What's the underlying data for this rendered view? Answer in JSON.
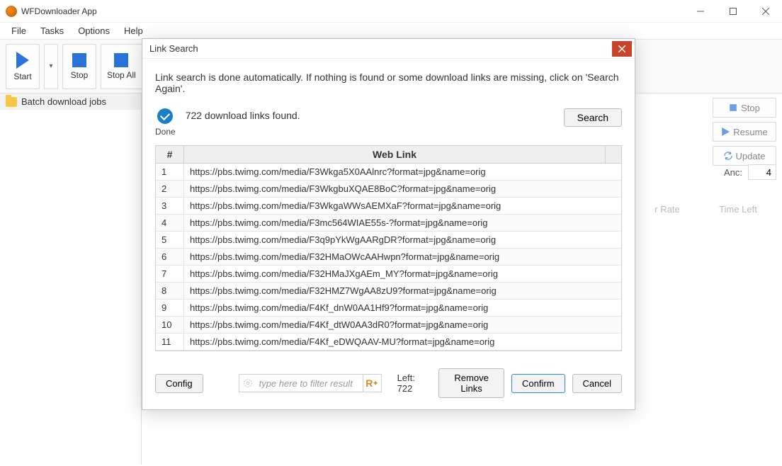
{
  "window": {
    "title": "WFDownloader App"
  },
  "menubar": [
    "File",
    "Tasks",
    "Options",
    "Help"
  ],
  "toolbar": {
    "start": "Start",
    "stop": "Stop",
    "stop_all": "Stop All"
  },
  "sidebar": {
    "item": "Batch download jobs"
  },
  "right_panel": {
    "stop": "Stop",
    "resume": "Resume",
    "update": "Update",
    "anc_label": "Anc:",
    "anc_value": "4"
  },
  "bg_tabs": {
    "rate": "r Rate",
    "time": "Time Left"
  },
  "dialog": {
    "title": "Link Search",
    "desc": "Link search is done automatically. If nothing is found or some download links are missing, click on 'Search Again'.",
    "done": "Done",
    "found": "722 download links found.",
    "search": "Search",
    "col_num": "#",
    "col_link": "Web Link",
    "rows": [
      {
        "n": "1",
        "url": "https://pbs.twimg.com/media/F3Wkga5X0AAlnrc?format=jpg&name=orig"
      },
      {
        "n": "2",
        "url": "https://pbs.twimg.com/media/F3WkgbuXQAE8BoC?format=jpg&name=orig"
      },
      {
        "n": "3",
        "url": "https://pbs.twimg.com/media/F3WkgaWWsAEMXaF?format=jpg&name=orig"
      },
      {
        "n": "4",
        "url": "https://pbs.twimg.com/media/F3mc564WIAE55s-?format=jpg&name=orig"
      },
      {
        "n": "5",
        "url": "https://pbs.twimg.com/media/F3q9pYkWgAARgDR?format=jpg&name=orig"
      },
      {
        "n": "6",
        "url": "https://pbs.twimg.com/media/F32HMaOWcAAHwpn?format=jpg&name=orig"
      },
      {
        "n": "7",
        "url": "https://pbs.twimg.com/media/F32HMaJXgAEm_MY?format=jpg&name=orig"
      },
      {
        "n": "8",
        "url": "https://pbs.twimg.com/media/F32HMZ7WgAA8zU9?format=jpg&name=orig"
      },
      {
        "n": "9",
        "url": "https://pbs.twimg.com/media/F4Kf_dnW0AA1Hf9?format=jpg&name=orig"
      },
      {
        "n": "10",
        "url": "https://pbs.twimg.com/media/F4Kf_dtW0AA3dR0?format=jpg&name=orig"
      },
      {
        "n": "11",
        "url": "https://pbs.twimg.com/media/F4Kf_eDWQAAV-MU?format=jpg&name=orig"
      }
    ],
    "config": "Config",
    "filter_placeholder": "type here to filter result",
    "left": "Left: 722",
    "remove": "Remove Links",
    "confirm": "Confirm",
    "cancel": "Cancel"
  }
}
